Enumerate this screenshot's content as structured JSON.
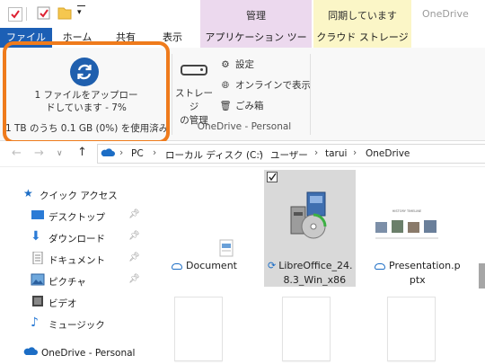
{
  "title_bar": {
    "context_manage": "管理",
    "context_sync": "同期しています",
    "window_title": "OneDrive"
  },
  "tabs": {
    "file": "ファイル",
    "home": "ホーム",
    "share": "共有",
    "view": "表示",
    "app_tools": "アプリケーション ツール",
    "cloud_storage": "クラウド ストレージ"
  },
  "ribbon": {
    "upload_status_line1": "1 ファイルをアップロー",
    "upload_status_line2": "ドしています - 7%",
    "upload_progress_percent": 7,
    "usage": "1 TB のうち 0.1 GB (0%) を使用済み",
    "storage_manage_line1": "ストレージ",
    "storage_manage_line2": "の管理",
    "settings": "設定",
    "view_online": "オンラインで表示",
    "recycle_bin": "ごみ箱",
    "group_label": "OneDrive - Personal"
  },
  "address": {
    "crumbs": [
      "PC",
      "ローカル ディスク (C:)",
      "ユーザー",
      "tarui",
      "OneDrive"
    ]
  },
  "nav_pane": {
    "quick_access": "クイック アクセス",
    "desktop": "デスクトップ",
    "downloads": "ダウンロード",
    "documents": "ドキュメント",
    "pictures": "ピクチャ",
    "videos": "ビデオ",
    "music": "ミュージック",
    "onedrive": "OneDrive - Personal"
  },
  "files": {
    "document": "Document",
    "libreoffice_line1": "LibreOffice_24.",
    "libreoffice_line2": "8.3_Win_x86",
    "presentation_line1": "Presentation.p",
    "presentation_line2": "ptx",
    "presentation_thumb_title": "HISTORY TIMELINE"
  },
  "colors": {
    "accent": "#1c5fb5",
    "highlight": "#ef7b1c",
    "manage_tab": "#ecd9ee",
    "sync_tab": "#fbf6c7"
  }
}
